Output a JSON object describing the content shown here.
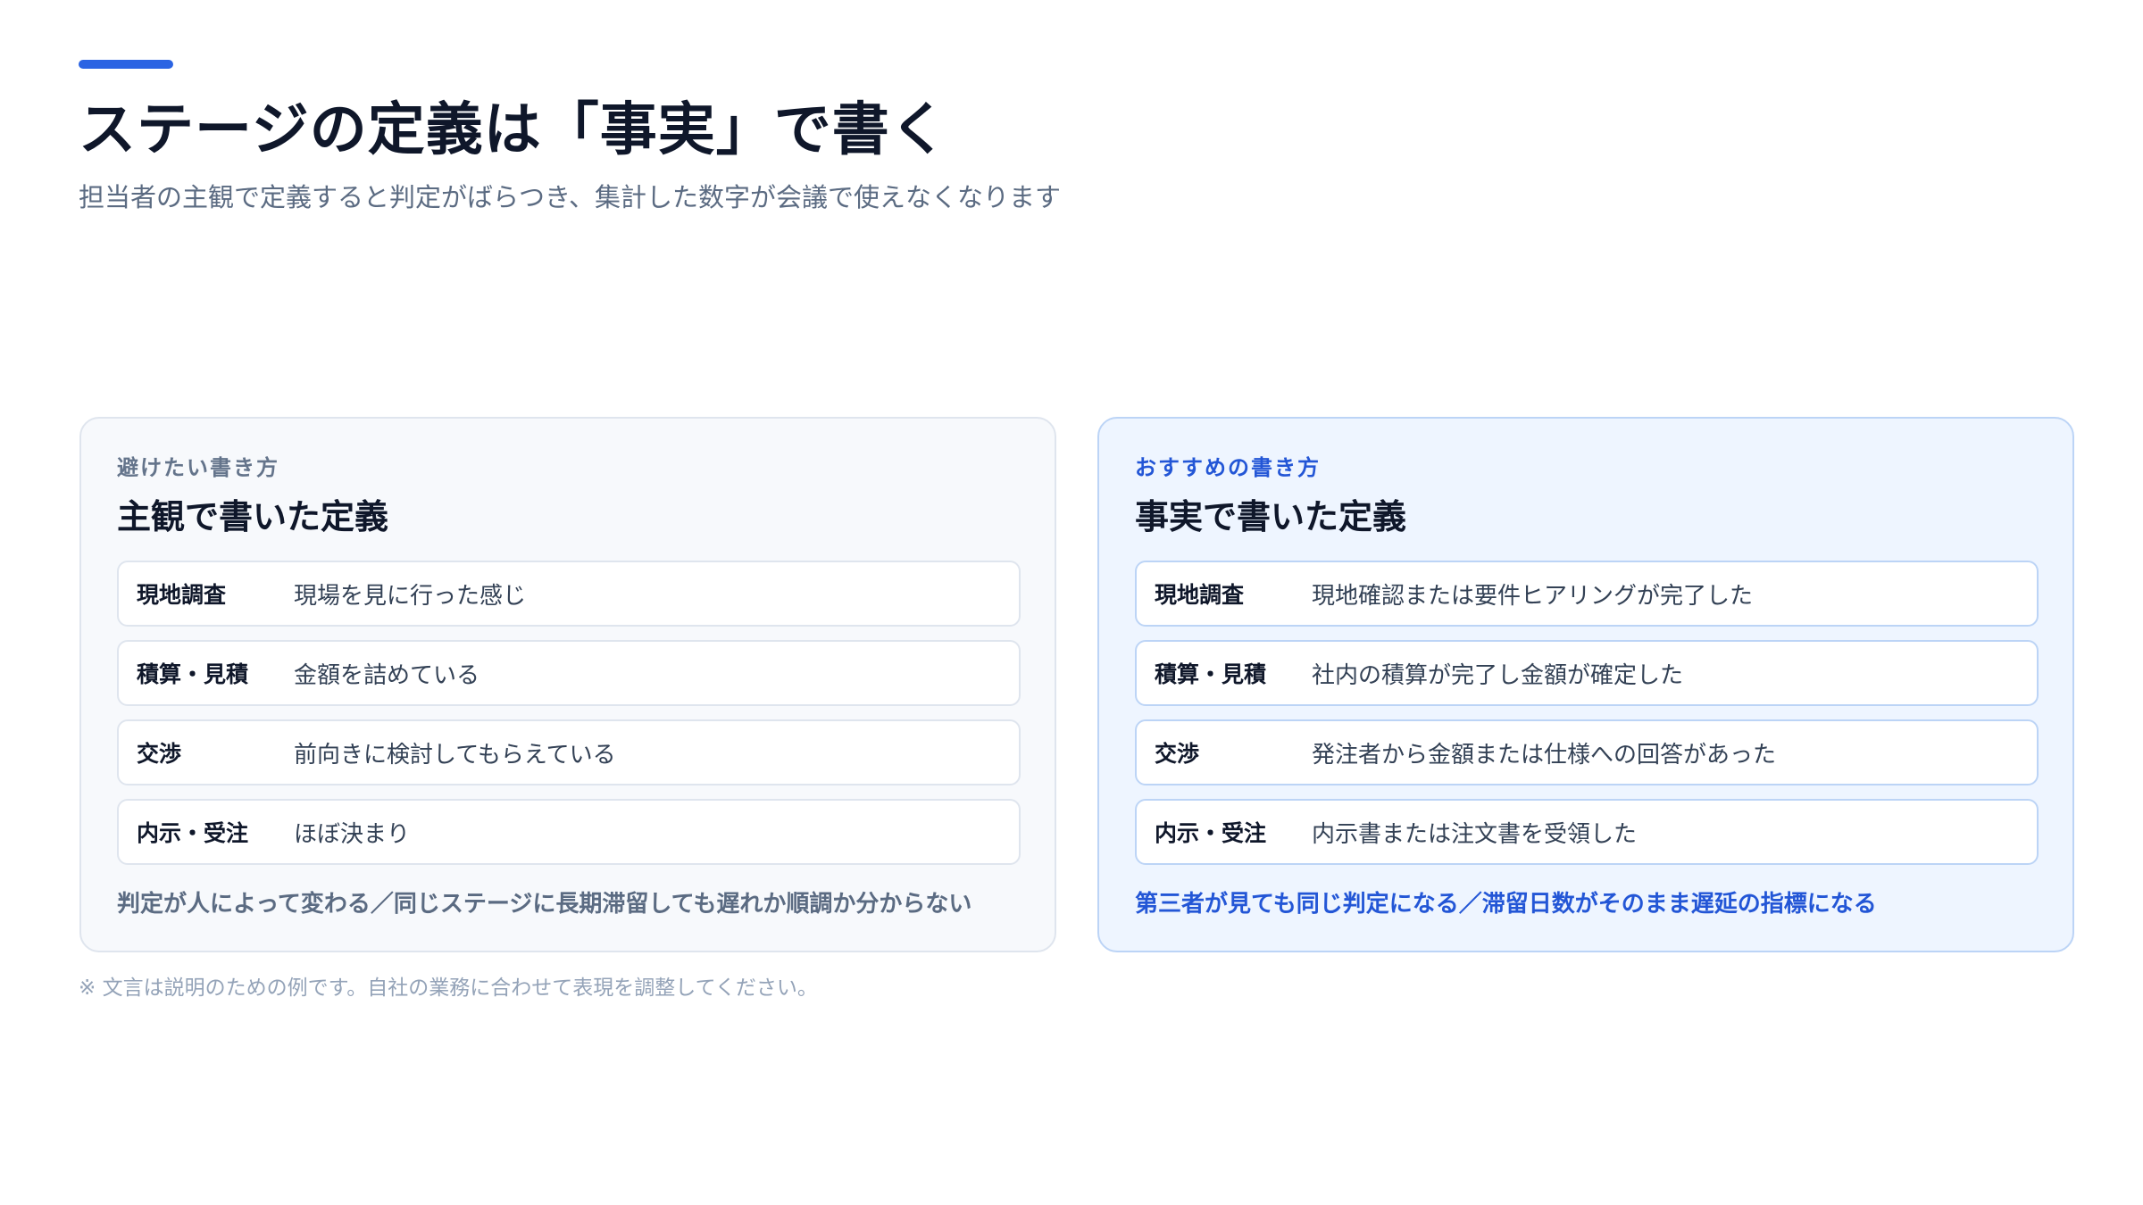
{
  "header": {
    "title": "ステージの定義は「事実」で書く",
    "subtitle": "担当者の主観で定義すると判定がばらつき、集計した数字が会議で使えなくなります",
    "accent_color": "#2b64e3"
  },
  "panels": {
    "avoid": {
      "kicker": "避けたい書き方",
      "heading": "主観で書いた定義",
      "rows": [
        {
          "stage": "現地調査",
          "definition": "現場を見に行った感じ"
        },
        {
          "stage": "積算・見積",
          "definition": "金額を詰めている"
        },
        {
          "stage": "交渉",
          "definition": "前向きに検討してもらえている"
        },
        {
          "stage": "内示・受注",
          "definition": "ほぼ決まり"
        }
      ],
      "footer": "判定が人によって変わる／同じステージに長期滞留しても遅れか順調か分からない"
    },
    "recommended": {
      "kicker": "おすすめの書き方",
      "heading": "事実で書いた定義",
      "rows": [
        {
          "stage": "現地調査",
          "definition": "現地確認または要件ヒアリングが完了した"
        },
        {
          "stage": "積算・見積",
          "definition": "社内の積算が完了し金額が確定した"
        },
        {
          "stage": "交渉",
          "definition": "発注者から金額または仕様への回答があった"
        },
        {
          "stage": "内示・受注",
          "definition": "内示書または注文書を受領した"
        }
      ],
      "footer": "第三者が見ても同じ判定になる／滞留日数がそのまま遅延の指標になる",
      "accent_color": "#2356d6"
    }
  },
  "footnote": "※ 文言は説明のための例です。自社の業務に合わせて表現を調整してください。"
}
